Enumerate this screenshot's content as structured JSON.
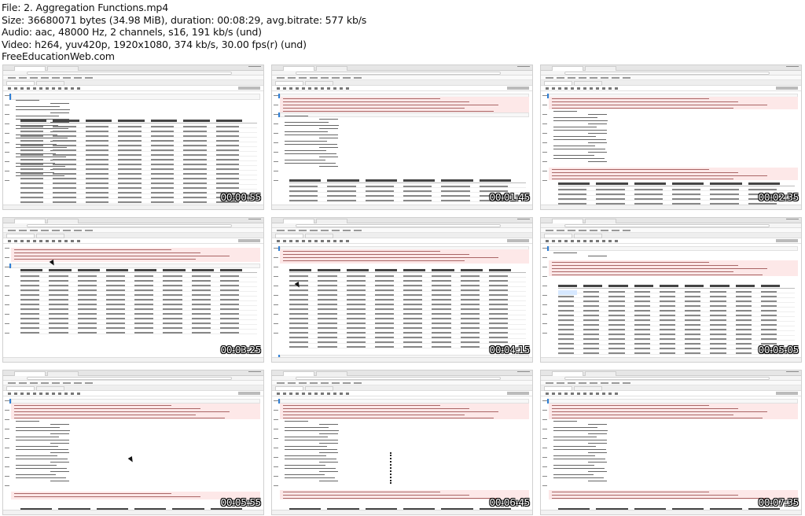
{
  "header": {
    "file": "File: 2. Aggregation Functions.mp4",
    "size": "Size: 36680071 bytes (34.98 MiB), duration: 00:08:29, avg.bitrate: 577 kb/s",
    "audio": "Audio: aac, 48000 Hz, 2 channels, s16, 191 kb/s (und)",
    "video": "Video: h264, yuv420p, 1920x1080, 374 kb/s, 30.00 fps(r) (und)",
    "site": "FreeEducationWeb.com"
  },
  "thumbnails": [
    {
      "timestamp": "00:00:55"
    },
    {
      "timestamp": "00:01:45"
    },
    {
      "timestamp": "00:02:35"
    },
    {
      "timestamp": "00:03:25"
    },
    {
      "timestamp": "00:04:15"
    },
    {
      "timestamp": "00:05:05"
    },
    {
      "timestamp": "00:05:55"
    },
    {
      "timestamp": "00:06:45"
    },
    {
      "timestamp": "00:07:35"
    }
  ]
}
